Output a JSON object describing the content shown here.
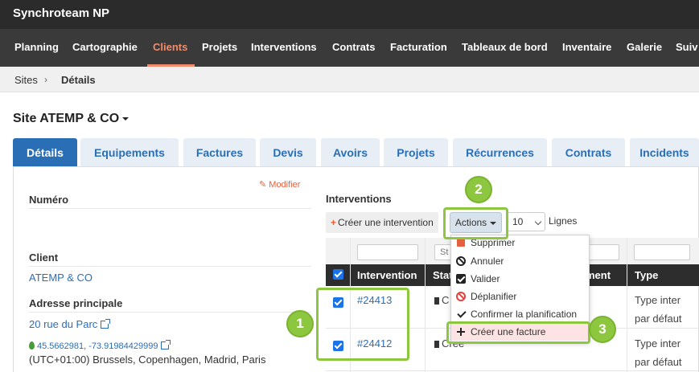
{
  "app": {
    "title": "Synchroteam NP"
  },
  "nav": {
    "items": [
      {
        "label": "Planning"
      },
      {
        "label": "Cartographie"
      },
      {
        "label": "Clients"
      },
      {
        "label": "Projets"
      },
      {
        "label": "Interventions"
      },
      {
        "label": "Contrats"
      },
      {
        "label": "Facturation"
      },
      {
        "label": "Tableaux de bord"
      },
      {
        "label": "Inventaire"
      },
      {
        "label": "Galerie"
      },
      {
        "label": "Suiv"
      }
    ],
    "active": "Clients"
  },
  "breadcrumb": {
    "parent": "Sites",
    "current": "Détails"
  },
  "site": {
    "title": "Site ATEMP & CO"
  },
  "tabs": [
    {
      "label": "Détails"
    },
    {
      "label": "Equipements"
    },
    {
      "label": "Factures"
    },
    {
      "label": "Devis"
    },
    {
      "label": "Avoirs"
    },
    {
      "label": "Projets"
    },
    {
      "label": "Récurrences"
    },
    {
      "label": "Contrats"
    },
    {
      "label": "Incidents"
    }
  ],
  "details": {
    "modifier_label": "Modifier",
    "numero_label": "Numéro",
    "client_label": "Client",
    "client_value": "ATEMP & CO",
    "address_label": "Adresse principale",
    "address_value": "20 rue du Parc",
    "coords_value": "45.5662981, -73.91984429999",
    "timezone_value": "(UTC+01:00) Brussels, Copenhagen, Madrid, Paris"
  },
  "interventions": {
    "title": "Interventions",
    "create_label": "Créer une intervention",
    "actions_label": "Actions",
    "page_size": "10",
    "lignes_label": "Lignes",
    "filter_placeholder_status": "St",
    "columns": {
      "intervention": "Intervention",
      "status": "Stat",
      "comment": "ment",
      "type": "Type"
    },
    "rows": [
      {
        "id": "#24413",
        "status": "C",
        "type_line1": "Type inter",
        "type_line2": "par défaut"
      },
      {
        "id": "#24412",
        "status": "Cree",
        "type_line1": "Type inter",
        "type_line2": "par défaut"
      }
    ]
  },
  "actions_menu": {
    "items": [
      {
        "label": "Supprimer",
        "icon": "trash-icon"
      },
      {
        "label": "Annuler",
        "icon": "ban-icon"
      },
      {
        "label": "Valider",
        "icon": "check-square-icon"
      },
      {
        "label": "Déplanifier",
        "icon": "ban-red-icon"
      },
      {
        "label": "Confirmer la planification",
        "icon": "check-icon"
      },
      {
        "label": "Créer une facture",
        "icon": "plus-icon"
      }
    ]
  },
  "annotations": {
    "step1": "1",
    "step2": "2",
    "step3": "3"
  },
  "colors": {
    "accent": "#2a6fb6",
    "nav_active": "#f28c6b",
    "highlight": "#8dc63f",
    "danger": "#e4603f"
  }
}
